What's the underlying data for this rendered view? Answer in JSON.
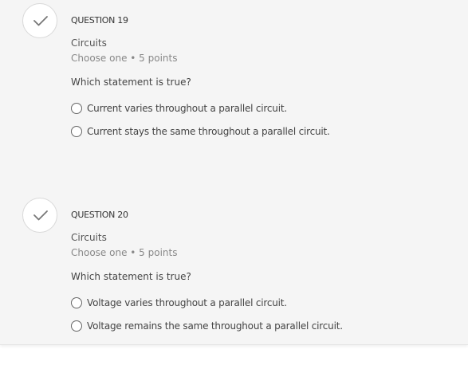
{
  "questions": [
    {
      "number_label": "QUESTION 19",
      "topic": "Circuits",
      "meta": "Choose one • 5 points",
      "prompt": "Which statement is true?",
      "options": [
        "Current varies throughout a parallel circuit.",
        "Current stays the same throughout a parallel circuit."
      ],
      "status_icon": "checkmark-icon"
    },
    {
      "number_label": "QUESTION 20",
      "topic": "Circuits",
      "meta": "Choose one • 5 points",
      "prompt": "Which statement is true?",
      "options": [
        "Voltage varies throughout a parallel circuit.",
        "Voltage remains the same throughout a parallel circuit."
      ],
      "status_icon": "checkmark-icon"
    }
  ],
  "colors": {
    "panel_background": "#f5f5f5",
    "check_color": "#777777",
    "meta_text": "#888888"
  }
}
